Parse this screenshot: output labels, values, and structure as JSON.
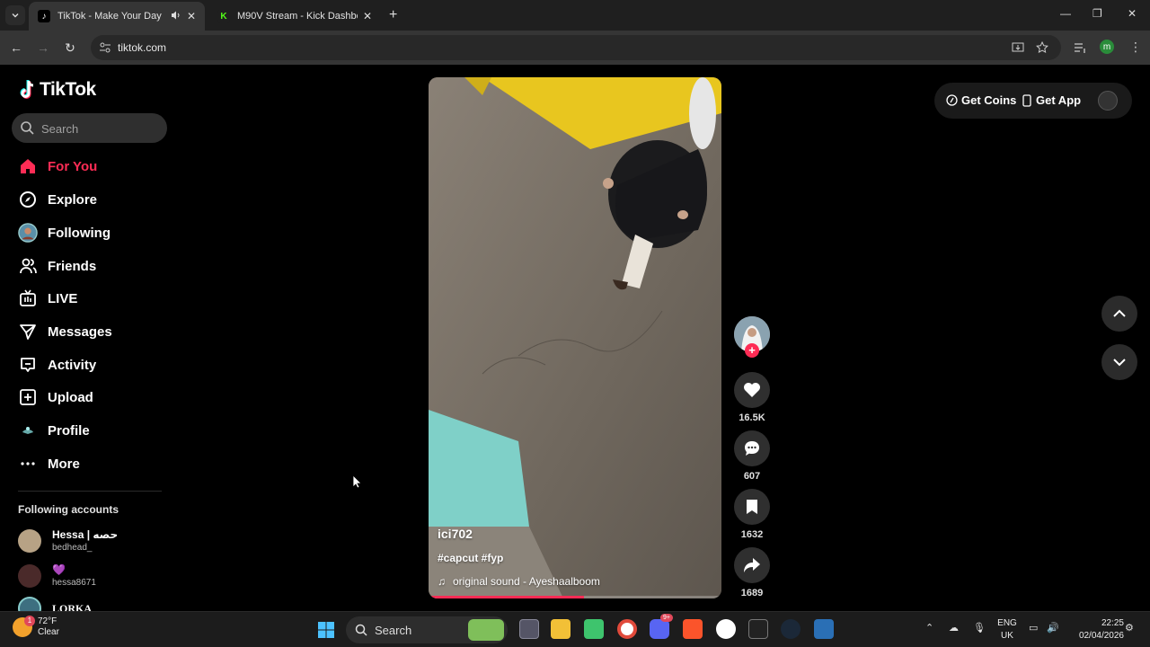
{
  "browser": {
    "tabs": [
      {
        "title": "TikTok - Make Your Day",
        "active": true
      },
      {
        "title": "M90V Stream - Kick Dashboard",
        "active": false
      }
    ],
    "url": "tiktok.com",
    "profile_initial": "m"
  },
  "sidebar": {
    "logo_text": "TikTok",
    "search_placeholder": "Search",
    "items": [
      {
        "label": "For You",
        "icon": "home-icon",
        "active": true
      },
      {
        "label": "Explore",
        "icon": "compass-icon"
      },
      {
        "label": "Following",
        "icon": "following-avatar-icon"
      },
      {
        "label": "Friends",
        "icon": "friends-icon"
      },
      {
        "label": "LIVE",
        "icon": "live-icon"
      },
      {
        "label": "Messages",
        "icon": "send-icon"
      },
      {
        "label": "Activity",
        "icon": "activity-icon"
      },
      {
        "label": "Upload",
        "icon": "upload-icon"
      },
      {
        "label": "Profile",
        "icon": "profile-avatar-icon"
      },
      {
        "label": "More",
        "icon": "more-dots-icon"
      }
    ],
    "following_header": "Following accounts",
    "following_accounts": [
      {
        "name": "Hessa | حصه",
        "handle": "bedhead_"
      },
      {
        "name": "💜",
        "handle": "hessa8671"
      },
      {
        "name": "LORKA",
        "handle": ""
      }
    ]
  },
  "video": {
    "username": "ici702",
    "hashtags": "#capcut #fyp",
    "sound": "original sound - Ayeshaalboom",
    "progress": 0.53
  },
  "actions": {
    "likes": "16.5K",
    "comments": "607",
    "saves": "1632",
    "shares": "1689"
  },
  "topbar": {
    "get_coins": "Get Coins",
    "get_app": "Get App"
  },
  "taskbar": {
    "temperature": "72°F",
    "condition": "Clear",
    "weather_badge": "1",
    "search_label": "Search",
    "lang_line1": "ENG",
    "lang_line2": "UK",
    "time": "22:25",
    "date": "02/04/2026",
    "discord_badge": "9+"
  },
  "colors": {
    "accent": "#fe2c55",
    "background": "#000000"
  }
}
